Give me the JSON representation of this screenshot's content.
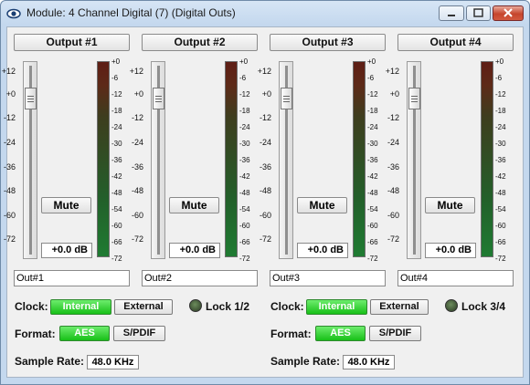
{
  "window": {
    "title": "Module: 4 Channel Digital (7) (Digital Outs)",
    "icon": "eye-icon"
  },
  "fader_scale": [
    "+12",
    "+0",
    "-12",
    "-24",
    "-36",
    "-48",
    "-60",
    "-72"
  ],
  "meter_scale": [
    "+0",
    "-6",
    "-12",
    "-18",
    "-24",
    "-30",
    "-36",
    "-42",
    "-48",
    "-54",
    "-60",
    "-66",
    "-72"
  ],
  "channels": [
    {
      "header": "Output #1",
      "mute_label": "Mute",
      "gain": "+0.0 dB",
      "name": "Out#1"
    },
    {
      "header": "Output #2",
      "mute_label": "Mute",
      "gain": "+0.0 dB",
      "name": "Out#2"
    },
    {
      "header": "Output #3",
      "mute_label": "Mute",
      "gain": "+0.0 dB",
      "name": "Out#3"
    },
    {
      "header": "Output #4",
      "mute_label": "Mute",
      "gain": "+0.0 dB",
      "name": "Out#4"
    }
  ],
  "groups": [
    {
      "clock_label": "Clock:",
      "clock_internal": "Internal",
      "clock_external": "External",
      "clock_selected": "Internal",
      "lock_label": "Lock 1/2",
      "format_label": "Format:",
      "format_aes": "AES",
      "format_spdif": "S/PDIF",
      "format_selected": "AES",
      "sample_rate_label": "Sample Rate:",
      "sample_rate": "48.0 KHz"
    },
    {
      "clock_label": "Clock:",
      "clock_internal": "Internal",
      "clock_external": "External",
      "clock_selected": "Internal",
      "lock_label": "Lock 3/4",
      "format_label": "Format:",
      "format_aes": "AES",
      "format_spdif": "S/PDIF",
      "format_selected": "AES",
      "sample_rate_label": "Sample Rate:",
      "sample_rate": "48.0 KHz"
    }
  ],
  "colors": {
    "selected_button": "#18c018",
    "meter_top": "#5e1e15",
    "meter_bottom": "#1f7b32"
  }
}
